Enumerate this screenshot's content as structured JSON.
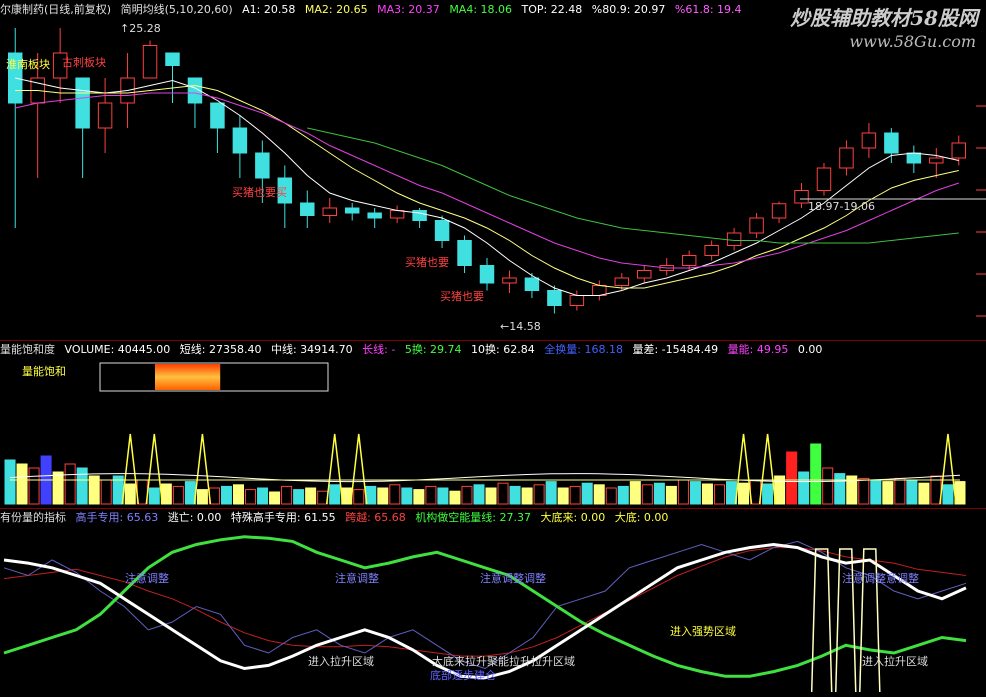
{
  "top_header": {
    "stock": "尔康制药(日线,前复权)",
    "indicator": "简明均线(5,10,20,60)",
    "a1": "A1: 20.58",
    "ma2": "MA2: 20.65",
    "ma3": "MA3: 20.37",
    "ma4": "MA4: 18.06",
    "top": "TOP: 22.48",
    "pct": "%80.9: 20.97",
    "pct2": "%61.8: 19.4"
  },
  "watermark": {
    "line1": "炒股辅助教材58股网",
    "line2": "www.58Gu.com"
  },
  "price_chart": {
    "annotations": [
      "25.28",
      "18.97-19.06",
      "14.58",
      "淮南板块",
      "古刺板块",
      "买猪也要买",
      "买猪也要",
      "买猪也要"
    ],
    "candles": [
      [
        25,
        23,
        18,
        26
      ],
      [
        23,
        24,
        20,
        25
      ],
      [
        24,
        25,
        23,
        26
      ],
      [
        24,
        22,
        20,
        24
      ],
      [
        22,
        23,
        21,
        24
      ],
      [
        23,
        24,
        22,
        25
      ],
      [
        24,
        25.3,
        24,
        25.5
      ],
      [
        25,
        24.5,
        23,
        25
      ],
      [
        24,
        23,
        22,
        24
      ],
      [
        23,
        22,
        21,
        23
      ],
      [
        22,
        21,
        20,
        22.5
      ],
      [
        21,
        20,
        19,
        21.5
      ],
      [
        20,
        19,
        18,
        20.5
      ],
      [
        19,
        18.5,
        18,
        19.5
      ],
      [
        18.5,
        18.8,
        18.2,
        19.2
      ],
      [
        18.8,
        18.6,
        18.3,
        19.0
      ],
      [
        18.6,
        18.4,
        18.0,
        18.8
      ],
      [
        18.4,
        18.7,
        18.2,
        18.9
      ],
      [
        18.7,
        18.3,
        18.0,
        18.8
      ],
      [
        18.3,
        17.5,
        17.2,
        18.5
      ],
      [
        17.5,
        16.5,
        16.2,
        17.7
      ],
      [
        16.5,
        15.8,
        15.5,
        16.8
      ],
      [
        15.8,
        16.0,
        15.4,
        16.3
      ],
      [
        16.0,
        15.5,
        15.2,
        16.2
      ],
      [
        15.5,
        14.9,
        14.58,
        15.7
      ],
      [
        14.9,
        15.3,
        14.7,
        15.5
      ],
      [
        15.3,
        15.7,
        15.1,
        15.9
      ],
      [
        15.7,
        16.0,
        15.5,
        16.2
      ],
      [
        16.0,
        16.3,
        15.8,
        16.5
      ],
      [
        16.3,
        16.5,
        16.1,
        16.8
      ],
      [
        16.5,
        16.9,
        16.3,
        17.1
      ],
      [
        16.9,
        17.3,
        16.7,
        17.5
      ],
      [
        17.3,
        17.8,
        17.1,
        18.0
      ],
      [
        17.8,
        18.4,
        17.6,
        18.6
      ],
      [
        18.4,
        18.97,
        18.2,
        19.06
      ],
      [
        19.0,
        19.5,
        18.8,
        19.8
      ],
      [
        19.5,
        20.4,
        19.3,
        20.6
      ],
      [
        20.4,
        21.2,
        20.1,
        21.5
      ],
      [
        21.2,
        21.8,
        20.8,
        22.2
      ],
      [
        21.8,
        21.0,
        20.6,
        22.0
      ],
      [
        21.0,
        20.6,
        20.2,
        21.3
      ],
      [
        20.6,
        20.8,
        20.0,
        21.2
      ],
      [
        20.8,
        21.4,
        20.5,
        21.7
      ]
    ],
    "ma_series": [
      {
        "color": "#ffffff",
        "values": [
          24,
          23.8,
          23.6,
          23.5,
          23.4,
          23.5,
          23.7,
          23.9,
          23.6,
          23.1,
          22.5,
          21.8,
          21.0,
          20.1,
          19.4,
          19.1,
          18.9,
          18.7,
          18.6,
          18.4,
          18.0,
          17.4,
          16.7,
          16.1,
          15.6,
          15.3,
          15.3,
          15.5,
          15.8,
          16.0,
          16.3,
          16.6,
          17.0,
          17.4,
          17.9,
          18.4,
          19.0,
          19.7,
          20.4,
          20.9,
          21.0,
          20.9,
          20.7
        ]
      },
      {
        "color": "#ffff80",
        "values": [
          23.5,
          23.5,
          23.4,
          23.4,
          23.4,
          23.4,
          23.5,
          23.6,
          23.7,
          23.5,
          23.1,
          22.7,
          22.2,
          21.6,
          21.0,
          20.4,
          19.9,
          19.4,
          19.0,
          18.7,
          18.4,
          18.0,
          17.5,
          16.9,
          16.4,
          16.0,
          15.7,
          15.6,
          15.6,
          15.8,
          16.0,
          16.2,
          16.5,
          16.9,
          17.2,
          17.6,
          18.0,
          18.5,
          19.1,
          19.6,
          19.9,
          20.1,
          20.3
        ]
      },
      {
        "color": "#e040e0",
        "values": [
          22.8,
          23.0,
          23.1,
          23.2,
          23.3,
          23.3,
          23.4,
          23.4,
          23.4,
          23.2,
          22.9,
          22.6,
          22.2,
          21.8,
          21.3,
          20.9,
          20.5,
          20.1,
          19.7,
          19.4,
          19.0,
          18.6,
          18.2,
          17.8,
          17.4,
          17.1,
          16.8,
          16.6,
          16.5,
          16.4,
          16.4,
          16.5,
          16.6,
          16.8,
          17.0,
          17.3,
          17.6,
          17.9,
          18.3,
          18.7,
          19.1,
          19.5,
          19.8
        ]
      },
      {
        "color": "#40c040",
        "values": [
          null,
          null,
          null,
          null,
          null,
          null,
          null,
          null,
          null,
          null,
          null,
          null,
          null,
          22.0,
          21.8,
          21.6,
          21.4,
          21.1,
          20.8,
          20.5,
          20.1,
          19.7,
          19.3,
          19.0,
          18.7,
          18.4,
          18.2,
          18.0,
          17.9,
          17.8,
          17.7,
          17.6,
          17.5,
          17.5,
          17.4,
          17.4,
          17.4,
          17.4,
          17.4,
          17.5,
          17.6,
          17.7,
          17.8
        ]
      }
    ]
  },
  "volume_header": {
    "name": "量能饱和度",
    "volume": "VOLUME: 40445.00",
    "short": "短线: 27358.40",
    "mid": "中线: 34914.70",
    "long": "长线: -",
    "h5": "5换: 29.74",
    "h10": "10换: 62.84",
    "h20": "全换量: 168.18",
    "diff": "量差: -15484.49",
    "energy": "量能: 49.95",
    "zero": "0.00",
    "saturation_label": "量能饱和"
  },
  "volume_chart": {
    "bars": [
      0.55,
      0.5,
      0.45,
      0.6,
      0.4,
      0.5,
      0.45,
      0.35,
      0.3,
      0.35,
      0.25,
      0.3,
      0.2,
      0.25,
      0.22,
      0.28,
      0.18,
      0.2,
      0.22,
      0.24,
      0.18,
      0.2,
      0.15,
      0.22,
      0.18,
      0.2,
      0.16,
      0.24,
      0.2,
      0.18,
      0.22,
      0.2,
      0.24,
      0.2,
      0.18,
      0.22,
      0.2,
      0.16,
      0.22,
      0.24,
      0.2,
      0.26,
      0.22,
      0.2,
      0.24,
      0.28,
      0.2,
      0.22,
      0.26,
      0.24,
      0.2,
      0.22,
      0.28,
      0.24,
      0.26,
      0.22,
      0.3,
      0.28,
      0.25,
      0.24,
      0.28,
      0.26,
      0.3,
      0.25,
      0.35,
      0.65,
      0.4,
      0.75,
      0.45,
      0.38,
      0.35,
      0.32,
      0.3,
      0.28,
      0.32,
      0.3,
      0.26,
      0.35,
      0.24,
      0.28
    ],
    "spikes": [
      10,
      12,
      16,
      27,
      29,
      61,
      63,
      78
    ],
    "saturation": 0.55
  },
  "indicator_header": {
    "name": "有份量的指标",
    "expert": "高手专用: 65.63",
    "escape": "逃亡: 0.00",
    "special": "特殊高手专用: 61.55",
    "leap": "跨越: 65.68",
    "inst": "机构做空能量线: 27.37",
    "bottom_up": "大底来: 0.00",
    "bottom": "大底: 0.00"
  },
  "indicator_chart": {
    "labels": [
      "注意调整",
      "注意调整",
      "注意调整调整",
      "注意调整意调整",
      "进入拉升区域",
      "大底来拉升聚能拉升拉升区域",
      "进入强势区域",
      "进入拉升区域",
      "底部逐步建仓"
    ],
    "white": [
      0.8,
      0.78,
      0.75,
      0.7,
      0.65,
      0.55,
      0.45,
      0.35,
      0.25,
      0.15,
      0.1,
      0.12,
      0.18,
      0.25,
      0.3,
      0.35,
      0.3,
      0.22,
      0.12,
      0.05,
      0.04,
      0.08,
      0.15,
      0.25,
      0.35,
      0.45,
      0.55,
      0.65,
      0.75,
      0.8,
      0.85,
      0.88,
      0.9,
      0.88,
      0.82,
      0.78,
      0.8,
      0.7,
      0.6,
      0.55,
      0.62
    ],
    "green": [
      0.2,
      0.25,
      0.3,
      0.35,
      0.45,
      0.6,
      0.75,
      0.85,
      0.9,
      0.93,
      0.95,
      0.94,
      0.92,
      0.85,
      0.8,
      0.75,
      0.78,
      0.82,
      0.85,
      0.8,
      0.75,
      0.7,
      0.6,
      0.5,
      0.4,
      0.32,
      0.25,
      0.18,
      0.12,
      0.08,
      0.05,
      0.05,
      0.08,
      0.12,
      0.18,
      0.25,
      0.22,
      0.2,
      0.25,
      0.3,
      0.28
    ],
    "blue": [
      0.75,
      0.7,
      0.8,
      0.72,
      0.6,
      0.5,
      0.35,
      0.4,
      0.5,
      0.45,
      0.25,
      0.2,
      0.3,
      0.35,
      0.25,
      0.2,
      0.3,
      0.35,
      0.25,
      0.15,
      0.1,
      0.2,
      0.3,
      0.5,
      0.55,
      0.6,
      0.75,
      0.8,
      0.85,
      0.9,
      0.85,
      0.8,
      0.88,
      0.92,
      0.85,
      0.75,
      0.7,
      0.6,
      0.55,
      0.6,
      0.65
    ],
    "red": [
      0.68,
      0.7,
      0.72,
      0.74,
      0.7,
      0.66,
      0.6,
      0.55,
      0.48,
      0.4,
      0.33,
      0.28,
      0.25,
      0.24,
      0.24,
      0.25,
      0.24,
      0.22,
      0.2,
      0.18,
      0.18,
      0.2,
      0.24,
      0.3,
      0.38,
      0.46,
      0.54,
      0.62,
      0.7,
      0.76,
      0.82,
      0.86,
      0.88,
      0.88,
      0.86,
      0.82,
      0.8,
      0.78,
      0.74,
      0.72,
      0.7
    ],
    "yellow_spikes": [
      34,
      35,
      36
    ]
  },
  "chart_data": [
    {
      "type": "line",
      "title": "简明均线(5,10,20,60)",
      "ylim": [
        14,
        26
      ]
    },
    {
      "type": "bar",
      "title": "量能饱和度"
    },
    {
      "type": "line",
      "title": "有份量的指标"
    }
  ]
}
